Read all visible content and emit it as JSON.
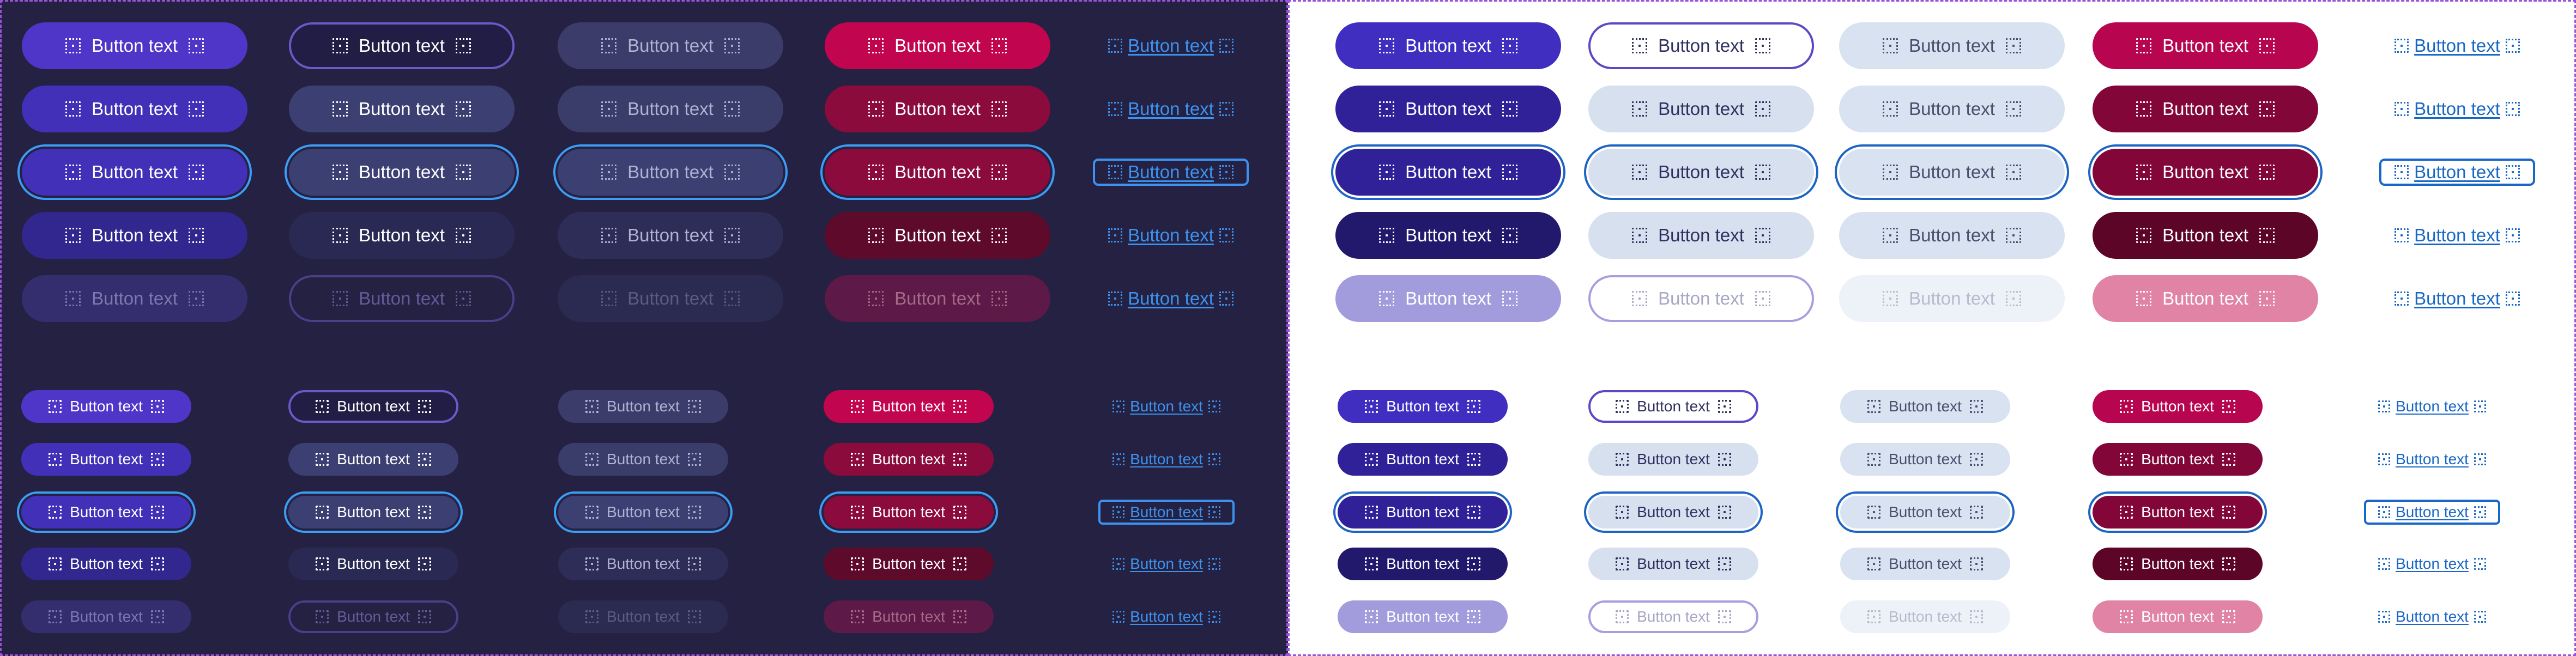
{
  "canvas": {
    "dark_bg": "#252142",
    "light_bg": "#ffffff",
    "frame_border": "#9a52d8"
  },
  "button_label": "Button text",
  "icon_left": "dashed-square-icon",
  "icon_right": "dashed-square-icon",
  "variants": [
    "primary",
    "secondary",
    "tertiary",
    "danger",
    "link"
  ],
  "states": [
    "default",
    "hover",
    "focus",
    "pressed",
    "disabled"
  ],
  "sizes": [
    "large",
    "small"
  ],
  "themes": {
    "dark": {
      "primary": [
        {
          "bg": "#4f35c8",
          "fg": "#ffffff"
        },
        {
          "bg": "#4330b8",
          "fg": "#ffffff"
        },
        {
          "bg": "#4330b8",
          "fg": "#ffffff",
          "ring": "#3b9df5"
        },
        {
          "bg": "#31278e",
          "fg": "#ffffff"
        },
        {
          "bg": "#342d6e",
          "fg": "#7f78b0"
        }
      ],
      "secondary": [
        {
          "bg": "#221d45",
          "fg": "#ffffff",
          "border": "#6a5ac7"
        },
        {
          "bg": "#3c3f72",
          "fg": "#ffffff"
        },
        {
          "bg": "#3c3f72",
          "fg": "#ffffff",
          "ring": "#3b9df5"
        },
        {
          "bg": "#2a2954",
          "fg": "#ffffff"
        },
        {
          "bg": "#252142",
          "fg": "#625c98",
          "border": "#4a3f8a"
        }
      ],
      "tertiary": [
        {
          "bg": "#3b3c6a",
          "fg": "#aeb3d3"
        },
        {
          "bg": "#3a3c6a",
          "fg": "#aeb3d3"
        },
        {
          "bg": "#3c3f72",
          "fg": "#aeb3d3",
          "ring": "#3b9df5"
        },
        {
          "bg": "#2d2d57",
          "fg": "#aeb3d3"
        },
        {
          "bg": "#2b2a50",
          "fg": "#5b5c82"
        }
      ],
      "danger": [
        {
          "bg": "#c2054f",
          "fg": "#ffffff"
        },
        {
          "bg": "#8a0b3c",
          "fg": "#ffffff"
        },
        {
          "bg": "#8a0b3c",
          "fg": "#ffffff",
          "ring": "#3b9df5"
        },
        {
          "bg": "#5e0a2b",
          "fg": "#ffffff"
        },
        {
          "bg": "#5d1947",
          "fg": "#a36b88"
        }
      ],
      "link": [
        {
          "fg": "#3c92ee"
        },
        {
          "fg": "#3c92ee"
        },
        {
          "fg": "#3c92ee",
          "ring": "#3c92ee"
        },
        {
          "fg": "#3c92ee"
        },
        {
          "fg": "#3c92ee"
        }
      ]
    },
    "light": {
      "primary": [
        {
          "bg": "#3f2ec0",
          "fg": "#ffffff"
        },
        {
          "bg": "#302199",
          "fg": "#ffffff"
        },
        {
          "bg": "#302199",
          "fg": "#ffffff",
          "ring": "#1d64c4"
        },
        {
          "bg": "#22196d",
          "fg": "#ffffff"
        },
        {
          "bg": "#a29bdc",
          "fg": "#ffffff"
        }
      ],
      "secondary": [
        {
          "bg": "#ffffff",
          "fg": "#303060",
          "border": "#5a48c7"
        },
        {
          "bg": "#d6e0ef",
          "fg": "#303060"
        },
        {
          "bg": "#d6e0ef",
          "fg": "#303060",
          "ring": "#1d64c4"
        },
        {
          "bg": "#d6e0ef",
          "fg": "#303060"
        },
        {
          "bg": "#ffffff",
          "fg": "#a7a7c4",
          "border": "#a79ee0"
        }
      ],
      "tertiary": [
        {
          "bg": "#d8e2f0",
          "fg": "#4a4f6e"
        },
        {
          "bg": "#d8e2f0",
          "fg": "#4a4f6e"
        },
        {
          "bg": "#d8e2f0",
          "fg": "#4a4f6e",
          "ring": "#1d64c4"
        },
        {
          "bg": "#d8e2f0",
          "fg": "#4a4f6e"
        },
        {
          "bg": "#edf1f8",
          "fg": "#b5bccd"
        }
      ],
      "danger": [
        {
          "bg": "#b7064f",
          "fg": "#ffffff"
        },
        {
          "bg": "#820638",
          "fg": "#ffffff"
        },
        {
          "bg": "#820638",
          "fg": "#ffffff",
          "ring": "#1d64c4"
        },
        {
          "bg": "#5c0526",
          "fg": "#ffffff"
        },
        {
          "bg": "#e083a4",
          "fg": "#ffffff"
        }
      ],
      "link": [
        {
          "fg": "#1967c6"
        },
        {
          "fg": "#1967c6"
        },
        {
          "fg": "#1967c6",
          "ring": "#1967c6"
        },
        {
          "fg": "#1967c6"
        },
        {
          "fg": "#1967c6"
        }
      ]
    }
  }
}
